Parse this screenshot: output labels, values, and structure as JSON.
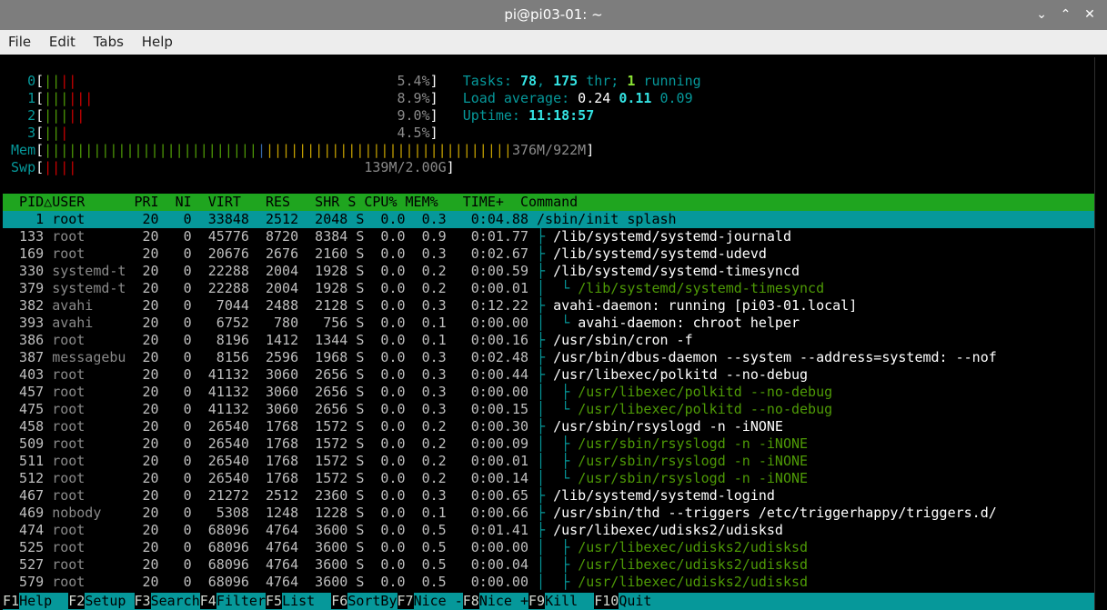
{
  "window": {
    "title": "pi@pi03-01: ~",
    "controls": [
      "⌄",
      "⌃",
      "✕"
    ]
  },
  "menu": [
    "File",
    "Edit",
    "Tabs",
    "Help"
  ],
  "meters": {
    "cpus": [
      {
        "label": "0",
        "bars_g": "||",
        "bars_r": "||",
        "value": "5.4%"
      },
      {
        "label": "1",
        "bars_g": "|||",
        "bars_r": "|||",
        "value": "8.9%"
      },
      {
        "label": "2",
        "bars_g": "|||",
        "bars_r": "||",
        "value": "9.0%"
      },
      {
        "label": "3",
        "bars_g": "||",
        "bars_r": "|",
        "value": "4.5%"
      }
    ],
    "mem": {
      "label": "Mem",
      "bars_g": "||||||||||||||||||||||||||",
      "bars_b": "|",
      "bars_y": "||||||||||||||||||||||||||||||",
      "value": "376M/922M"
    },
    "swp": {
      "label": "Swp",
      "bars_r": "||||",
      "value": "139M/2.00G"
    },
    "tasks_label": "Tasks: ",
    "tasks": "78",
    "thr": "175",
    "thr_label": " thr; ",
    "running": "1",
    "running_label": " running",
    "load_label": "Load average: ",
    "load1": "0.24",
    "load5": "0.11",
    "load15": "0.09",
    "uptime_label": "Uptime: ",
    "uptime": "11:18:57"
  },
  "header": {
    "pid": "PID",
    "sort_arrow": "△",
    "user": "USER",
    "pri": "PRI",
    "ni": "NI",
    "virt": "VIRT",
    "res": "RES",
    "shr": "SHR",
    "s": "S",
    "cpu": "CPU%",
    "mem": "MEM%",
    "time": "TIME+",
    "command": "Command"
  },
  "processes": [
    {
      "pid": "1",
      "user": "root",
      "pri": "20",
      "ni": "0",
      "virt": "33848",
      "res": "2512",
      "shr": "2048",
      "s": "S",
      "cpu": "0.0",
      "mem": "0.3",
      "time": "0:04.88",
      "tree": "",
      "cmd": "/sbin/init splash",
      "thread": false
    },
    {
      "pid": "133",
      "user": "root",
      "pri": "20",
      "ni": "0",
      "virt": "45776",
      "res": "8720",
      "shr": "8384",
      "s": "S",
      "cpu": "0.0",
      "mem": "0.9",
      "time": "0:01.77",
      "tree": "├ ",
      "cmd": "/lib/systemd/systemd-journald",
      "thread": false
    },
    {
      "pid": "169",
      "user": "root",
      "pri": "20",
      "ni": "0",
      "virt": "20676",
      "res": "2676",
      "shr": "2160",
      "s": "S",
      "cpu": "0.0",
      "mem": "0.3",
      "time": "0:02.67",
      "tree": "├ ",
      "cmd": "/lib/systemd/systemd-udevd",
      "thread": false
    },
    {
      "pid": "330",
      "user": "systemd-t",
      "pri": "20",
      "ni": "0",
      "virt": "22288",
      "res": "2004",
      "shr": "1928",
      "s": "S",
      "cpu": "0.0",
      "mem": "0.2",
      "time": "0:00.59",
      "tree": "├ ",
      "cmd": "/lib/systemd/systemd-timesyncd",
      "thread": false
    },
    {
      "pid": "379",
      "user": "systemd-t",
      "pri": "20",
      "ni": "0",
      "virt": "22288",
      "res": "2004",
      "shr": "1928",
      "s": "S",
      "cpu": "0.0",
      "mem": "0.2",
      "time": "0:00.01",
      "tree": "│  └ ",
      "cmd": "/lib/systemd/systemd-timesyncd",
      "thread": true
    },
    {
      "pid": "382",
      "user": "avahi",
      "pri": "20",
      "ni": "0",
      "virt": "7044",
      "res": "2488",
      "shr": "2128",
      "s": "S",
      "cpu": "0.0",
      "mem": "0.3",
      "time": "0:12.22",
      "tree": "├ ",
      "cmd": "avahi-daemon: running [pi03-01.local]",
      "thread": false
    },
    {
      "pid": "393",
      "user": "avahi",
      "pri": "20",
      "ni": "0",
      "virt": "6752",
      "res": "780",
      "shr": "756",
      "s": "S",
      "cpu": "0.0",
      "mem": "0.1",
      "time": "0:00.00",
      "tree": "│  └ ",
      "cmd": "avahi-daemon: chroot helper",
      "thread": false
    },
    {
      "pid": "386",
      "user": "root",
      "pri": "20",
      "ni": "0",
      "virt": "8196",
      "res": "1412",
      "shr": "1344",
      "s": "S",
      "cpu": "0.0",
      "mem": "0.1",
      "time": "0:00.16",
      "tree": "├ ",
      "cmd": "/usr/sbin/cron -f",
      "thread": false
    },
    {
      "pid": "387",
      "user": "messagebu",
      "pri": "20",
      "ni": "0",
      "virt": "8156",
      "res": "2596",
      "shr": "1968",
      "s": "S",
      "cpu": "0.0",
      "mem": "0.3",
      "time": "0:02.48",
      "tree": "├ ",
      "cmd": "/usr/bin/dbus-daemon --system --address=systemd: --nof",
      "thread": false
    },
    {
      "pid": "403",
      "user": "root",
      "pri": "20",
      "ni": "0",
      "virt": "41132",
      "res": "3060",
      "shr": "2656",
      "s": "S",
      "cpu": "0.0",
      "mem": "0.3",
      "time": "0:00.44",
      "tree": "├ ",
      "cmd": "/usr/libexec/polkitd --no-debug",
      "thread": false
    },
    {
      "pid": "457",
      "user": "root",
      "pri": "20",
      "ni": "0",
      "virt": "41132",
      "res": "3060",
      "shr": "2656",
      "s": "S",
      "cpu": "0.0",
      "mem": "0.3",
      "time": "0:00.00",
      "tree": "│  ├ ",
      "cmd": "/usr/libexec/polkitd --no-debug",
      "thread": true
    },
    {
      "pid": "475",
      "user": "root",
      "pri": "20",
      "ni": "0",
      "virt": "41132",
      "res": "3060",
      "shr": "2656",
      "s": "S",
      "cpu": "0.0",
      "mem": "0.3",
      "time": "0:00.15",
      "tree": "│  └ ",
      "cmd": "/usr/libexec/polkitd --no-debug",
      "thread": true
    },
    {
      "pid": "458",
      "user": "root",
      "pri": "20",
      "ni": "0",
      "virt": "26540",
      "res": "1768",
      "shr": "1572",
      "s": "S",
      "cpu": "0.0",
      "mem": "0.2",
      "time": "0:00.30",
      "tree": "├ ",
      "cmd": "/usr/sbin/rsyslogd -n -iNONE",
      "thread": false
    },
    {
      "pid": "509",
      "user": "root",
      "pri": "20",
      "ni": "0",
      "virt": "26540",
      "res": "1768",
      "shr": "1572",
      "s": "S",
      "cpu": "0.0",
      "mem": "0.2",
      "time": "0:00.09",
      "tree": "│  ├ ",
      "cmd": "/usr/sbin/rsyslogd -n -iNONE",
      "thread": true
    },
    {
      "pid": "511",
      "user": "root",
      "pri": "20",
      "ni": "0",
      "virt": "26540",
      "res": "1768",
      "shr": "1572",
      "s": "S",
      "cpu": "0.0",
      "mem": "0.2",
      "time": "0:00.01",
      "tree": "│  ├ ",
      "cmd": "/usr/sbin/rsyslogd -n -iNONE",
      "thread": true
    },
    {
      "pid": "512",
      "user": "root",
      "pri": "20",
      "ni": "0",
      "virt": "26540",
      "res": "1768",
      "shr": "1572",
      "s": "S",
      "cpu": "0.0",
      "mem": "0.2",
      "time": "0:00.14",
      "tree": "│  └ ",
      "cmd": "/usr/sbin/rsyslogd -n -iNONE",
      "thread": true
    },
    {
      "pid": "467",
      "user": "root",
      "pri": "20",
      "ni": "0",
      "virt": "21272",
      "res": "2512",
      "shr": "2360",
      "s": "S",
      "cpu": "0.0",
      "mem": "0.3",
      "time": "0:00.65",
      "tree": "├ ",
      "cmd": "/lib/systemd/systemd-logind",
      "thread": false
    },
    {
      "pid": "469",
      "user": "nobody",
      "pri": "20",
      "ni": "0",
      "virt": "5308",
      "res": "1248",
      "shr": "1228",
      "s": "S",
      "cpu": "0.0",
      "mem": "0.1",
      "time": "0:00.66",
      "tree": "├ ",
      "cmd": "/usr/sbin/thd --triggers /etc/triggerhappy/triggers.d/",
      "thread": false
    },
    {
      "pid": "474",
      "user": "root",
      "pri": "20",
      "ni": "0",
      "virt": "68096",
      "res": "4764",
      "shr": "3600",
      "s": "S",
      "cpu": "0.0",
      "mem": "0.5",
      "time": "0:01.41",
      "tree": "├ ",
      "cmd": "/usr/libexec/udisks2/udisksd",
      "thread": false
    },
    {
      "pid": "525",
      "user": "root",
      "pri": "20",
      "ni": "0",
      "virt": "68096",
      "res": "4764",
      "shr": "3600",
      "s": "S",
      "cpu": "0.0",
      "mem": "0.5",
      "time": "0:00.00",
      "tree": "│  ├ ",
      "cmd": "/usr/libexec/udisks2/udisksd",
      "thread": true
    },
    {
      "pid": "527",
      "user": "root",
      "pri": "20",
      "ni": "0",
      "virt": "68096",
      "res": "4764",
      "shr": "3600",
      "s": "S",
      "cpu": "0.0",
      "mem": "0.5",
      "time": "0:00.04",
      "tree": "│  ├ ",
      "cmd": "/usr/libexec/udisks2/udisksd",
      "thread": true
    },
    {
      "pid": "579",
      "user": "root",
      "pri": "20",
      "ni": "0",
      "virt": "68096",
      "res": "4764",
      "shr": "3600",
      "s": "S",
      "cpu": "0.0",
      "mem": "0.5",
      "time": "0:00.00",
      "tree": "│  ├ ",
      "cmd": "/usr/libexec/udisks2/udisksd",
      "thread": true
    }
  ],
  "fkeys": [
    {
      "key": "F1",
      "label": "Help  "
    },
    {
      "key": "F2",
      "label": "Setup "
    },
    {
      "key": "F3",
      "label": "Search"
    },
    {
      "key": "F4",
      "label": "Filter"
    },
    {
      "key": "F5",
      "label": "List  "
    },
    {
      "key": "F6",
      "label": "SortBy"
    },
    {
      "key": "F7",
      "label": "Nice -"
    },
    {
      "key": "F8",
      "label": "Nice +"
    },
    {
      "key": "F9",
      "label": "Kill  "
    },
    {
      "key": "F10",
      "label": "Quit"
    }
  ]
}
